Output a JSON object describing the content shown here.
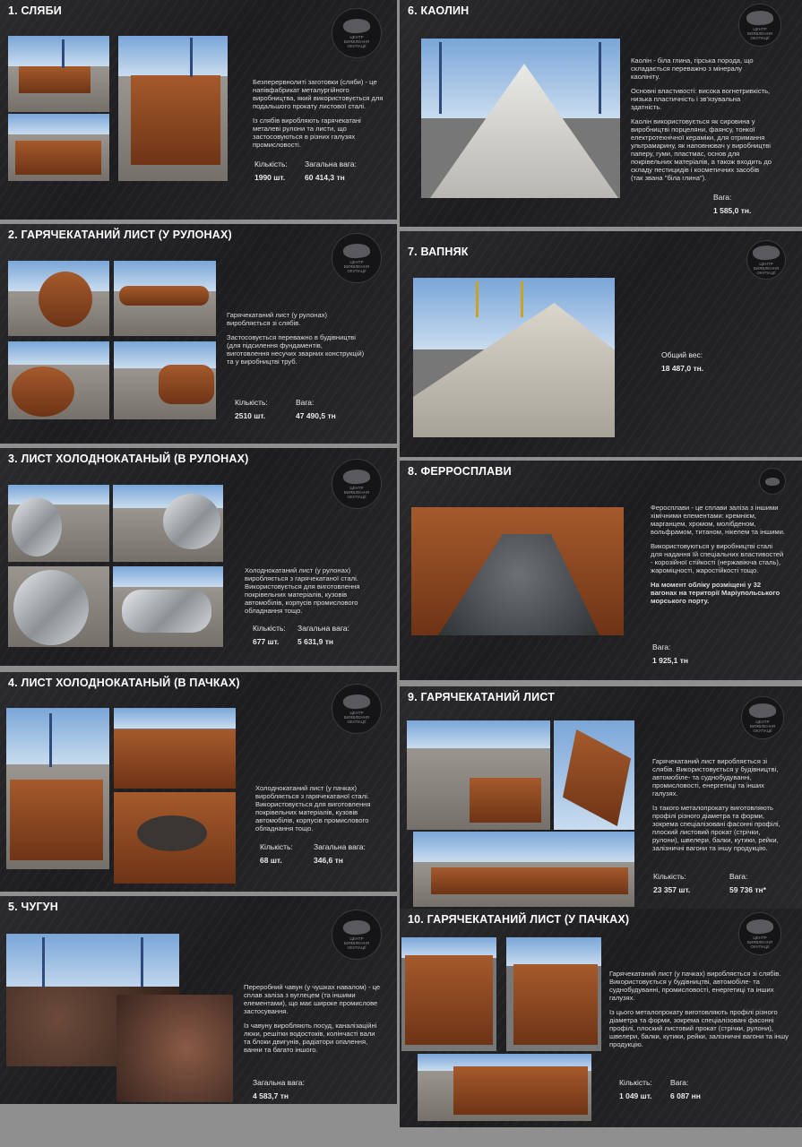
{
  "brand": {
    "logo_text": "ЦЕНТР ВИЯВЛЕННЯ ОКУПАЦІЇ"
  },
  "cards": {
    "slabs": {
      "title": "1. СЛЯБИ",
      "p1": "Безперервнолиті заготовки (сляби) - це напівфабрикат металургійного виробництва, який використовується для подальшого прокату листової сталі.",
      "p2": "Із слябів виробляють гарячекатані металеві рулони та листи, що застосовуються в різних галузях промисловості.",
      "qty_label": "Кількість:",
      "qty_value": "1990 шт.",
      "weight_label": "Загальна вага:",
      "weight_value": "60 414,3 тн"
    },
    "hot_rolled_coils": {
      "title": "2. ГАРЯЧЕКАТАНИЙ ЛИСТ (У РУЛОНАХ)",
      "p1": "Гарячекатаний лист (у рулонах) виробляється зі слябів.",
      "p2": "Застосовується переважно в будівництві (для підсилення фундаментів, виготовлення несучих зварних конструкцій) та у виробництві труб.",
      "qty_label": "Кількість:",
      "qty_value": "2510 шт.",
      "weight_label": "Вага:",
      "weight_value": "47 490,5 тн"
    },
    "cold_rolled_coils": {
      "title": "3. ЛИСТ ХОЛОДНОКАТАНЫЙ (В РУЛОНАХ)",
      "p1": "Холоднокатаний лист (у рулонах) виробляється з гарячекатаної сталі. Використовується для виготовлення покрівельних матеріалів, кузовів автомобілів, корпусів промислового обладнання тощо.",
      "qty_label": "Кількість:",
      "qty_value": "677 шт.",
      "weight_label": "Загальна вага:",
      "weight_value": "5 631,9 тн"
    },
    "cold_rolled_packs": {
      "title": "4. ЛИСТ ХОЛОДНОКАТАНЫЙ (В ПАЧКАХ)",
      "p1": "Холоднокатаний лист (у пачках) виробляється з гарячекатаної сталі. Використовується для виготовлення покрівельних матеріалів, кузовів автомобілів, корпусів промислового обладнання тощо.",
      "qty_label": "Кількість:",
      "qty_value": "68 шт.",
      "weight_label": "Загальна вага:",
      "weight_value": "346,6 тн"
    },
    "pig_iron": {
      "title": "5. ЧУГУН",
      "p1": "Переробний чавун (у чушках навалом) - це сплав заліза з вуглецем (та іншими елементами), що має широке промислове застосування.",
      "p2": "Із чавуну виробляють посуд, каналізаційні люки, решітки водостоків, колінчасті вали та блоки двигунів, радіатори опалення, ванни та багато іншого.",
      "weight_label": "Загальна вага:",
      "weight_value": "4 583,7 тн"
    },
    "kaolin": {
      "title": "6. КАОЛИН",
      "p1": "Каолін - біла глина, гірська порода, що складається переважно з мінералу каолініту.",
      "p2": "Основні властивості: висока вогнетривкість, низька пластичність і зв'язувальна здатність.",
      "p3": "Каолін використовується як сировина у виробництві порцеляни, фаянсу, тонкої електротехнічної кераміки, для отримання ультрамарину, як наповнювач у виробництві паперу, гуми, пластмас, основ для покрівельних матеріалів, а також входить до складу пестицидів і косметичних засобів (так звана \"біла глина\").",
      "weight_label": "Вага:",
      "weight_value": "1 585,0 тн."
    },
    "limestone": {
      "title": "7. ВАПНЯК",
      "weight_label": "Общий вес:",
      "weight_value": "18 487,0 тн."
    },
    "ferroalloys": {
      "title": "8. ФЕРРОСПЛАВИ",
      "p1": "Феросплави - це сплави заліза з іншими хімічними елементами: кремнієм, марганцем, хромом, молібденом, вольфрамом, титаном, нікелем та іншими.",
      "p2": "Використовуються у виробництві сталі для надання їй спеціальних властивостей - корозійної стійкості (нержавіюча сталь), жароміцності, жаростійкості тощо.",
      "p3": "На момент обліку розміщені у 32 вагонах на території Маріупольського морського порту.",
      "weight_label": "Вага:",
      "weight_value": "1 925,1 тн"
    },
    "hot_rolled_sheet": {
      "title": "9. ГАРЯЧЕКАТАНИЙ ЛИСТ",
      "p1": "Гарячекатаний лист виробляється зі слябів. Використовується у будівництві, автомобіле- та суднобудуванні, промисловості, енергетиці та інших галузях.",
      "p2": "Із такого металопрокату виготовляють профілі різного діаметра та форми, зокрема спеціалізовані фасонні профілі, плоский листовий прокат (стрічки, рулони), швелери, балки, кутики, рейки, залізничні вагони та іншу продукцію.",
      "qty_label": "Кількість:",
      "qty_value": "23 357 шт.",
      "weight_label": "Вага:",
      "weight_value": "59 736 тн*"
    },
    "hot_rolled_packs": {
      "title": "10. ГАРЯЧЕКАТАНИЙ ЛИСТ (У ПАЧКАХ)",
      "p1": "Гарячекатаний лист (у пачках) виробляється зі слябів. Використовується у будівництві, автомобіле- та суднобудуванні, промисловості, енергетиці та інших галузях.",
      "p2": "Із цього металопрокату виготовляють профілі різного діаметра та форми, зокрема спеціалізовані фасонні профілі, плоский листовий прокат (стрічки, рулони), швелери, балки, кутики, рейки, залізничні вагони та іншу продукцію.",
      "qty_label": "Кількість:",
      "qty_value": "1 049 шт.",
      "weight_label": "Вага:",
      "weight_value": "6 087 нн"
    }
  }
}
